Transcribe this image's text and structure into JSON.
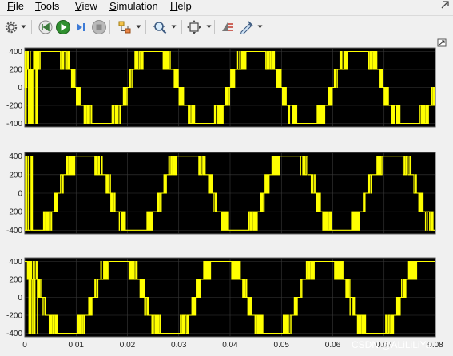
{
  "menu": {
    "items": [
      {
        "mnemonic": "F",
        "rest": "ile"
      },
      {
        "mnemonic": "T",
        "rest": "ools"
      },
      {
        "mnemonic": "V",
        "rest": "iew"
      },
      {
        "mnemonic": "S",
        "rest": "imulation"
      },
      {
        "mnemonic": "H",
        "rest": "elp"
      }
    ]
  },
  "toolbar": {
    "buttons": [
      {
        "name": "settings-icon",
        "has_dropdown": true
      },
      {
        "name": "step-back-icon",
        "has_dropdown": false
      },
      {
        "name": "run-icon",
        "has_dropdown": false
      },
      {
        "name": "step-forward-icon",
        "has_dropdown": false
      },
      {
        "name": "stop-icon",
        "has_dropdown": false
      },
      {
        "name": "highlight-block-icon",
        "has_dropdown": true
      },
      {
        "name": "zoom-icon",
        "has_dropdown": true
      },
      {
        "name": "fit-to-view-icon",
        "has_dropdown": true
      },
      {
        "name": "cursor-measurements-icon",
        "has_dropdown": false
      },
      {
        "name": "style-icon",
        "has_dropdown": true
      }
    ]
  },
  "watermark": "CSDN @ALiLiLiYa",
  "chart_data": [
    {
      "type": "line",
      "title": "",
      "xlabel": "",
      "ylabel": "",
      "xlim": [
        0,
        0.08
      ],
      "ylim": [
        -440,
        440
      ],
      "yticks": [
        400,
        200,
        0,
        -200,
        -400
      ],
      "xticks": [],
      "grid": true,
      "series": [
        {
          "color": "#ffff00",
          "phase": 0,
          "levels": [
            400,
            200,
            0,
            -200,
            -400
          ],
          "fundamental_hz": 50
        }
      ]
    },
    {
      "type": "line",
      "title": "",
      "xlabel": "",
      "ylabel": "",
      "xlim": [
        0,
        0.08
      ],
      "ylim": [
        -440,
        440
      ],
      "yticks": [
        400,
        200,
        0,
        -200,
        -400
      ],
      "xticks": [],
      "grid": true,
      "series": [
        {
          "color": "#ffff00",
          "phase": -120,
          "levels": [
            400,
            200,
            0,
            -200,
            -400
          ],
          "fundamental_hz": 50
        }
      ]
    },
    {
      "type": "line",
      "title": "",
      "xlabel": "",
      "ylabel": "",
      "xlim": [
        0,
        0.08
      ],
      "ylim": [
        -440,
        440
      ],
      "yticks": [
        400,
        200,
        0,
        -200,
        -400
      ],
      "xticks": [
        0,
        0.01,
        0.02,
        0.03,
        0.04,
        0.05,
        0.06,
        0.07,
        0.08
      ],
      "xtick_labels": [
        "0",
        "0.01",
        "0.02",
        "0.03",
        "0.04",
        "0.05",
        "0.06",
        "0.07",
        "0.08"
      ],
      "grid": true,
      "series": [
        {
          "color": "#ffff00",
          "phase": 120,
          "levels": [
            400,
            200,
            0,
            -200,
            -400
          ],
          "fundamental_hz": 50
        }
      ]
    }
  ]
}
